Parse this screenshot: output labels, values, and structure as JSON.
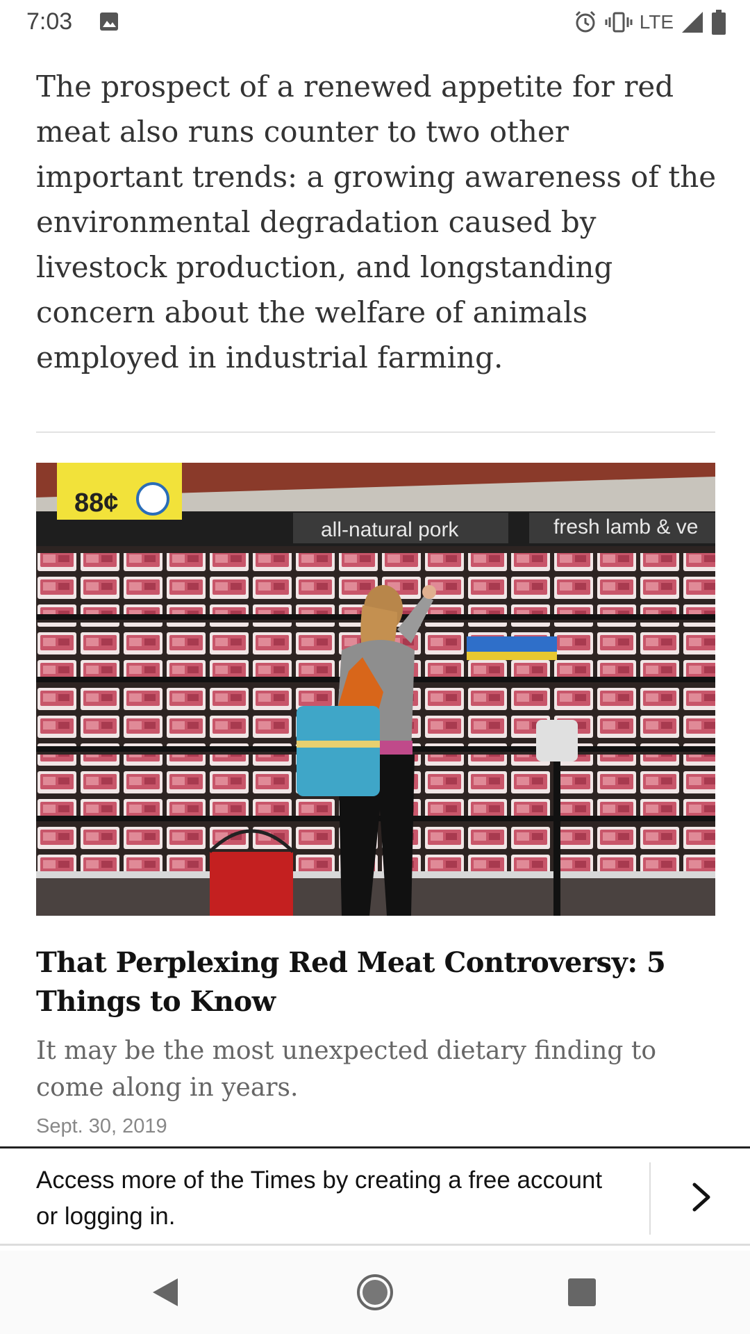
{
  "status_bar": {
    "time": "7:03",
    "network": "LTE",
    "icons": [
      "image-icon",
      "alarm-icon",
      "vibrate-icon",
      "signal-icon",
      "battery-icon"
    ]
  },
  "article": {
    "paragraph": "The prospect of a renewed appetite for red meat also runs counter to two other important trends: a growing awareness of the environmental degradation caused by livestock production, and longstanding concern about the welfare of animals employed in industrial farming."
  },
  "related_card": {
    "image": {
      "price_tag": "88¢",
      "sign_left": "all-natural pork",
      "sign_right": "fresh lamb & ve"
    },
    "title": "That Perplexing Red Meat Controversy: 5 Things to Know",
    "summary": "It may be the most unexpected dietary finding to come along in years.",
    "date": "Sept. 30, 2019"
  },
  "banner": {
    "text": "Access more of the Times by creating a free account or logging in.",
    "arrow_icon": "chevron-right-icon"
  },
  "nav_bar": {
    "icons": [
      "back-icon",
      "home-icon",
      "recents-icon"
    ]
  }
}
